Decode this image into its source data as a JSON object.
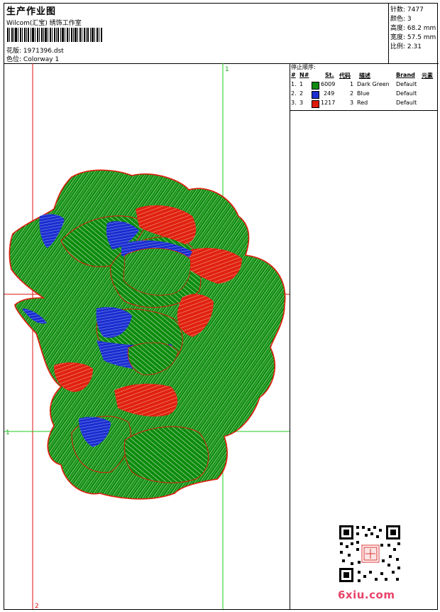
{
  "header": {
    "title": "生产作业图",
    "company": "Wilcom(汇宝) 绣饰工作室",
    "design_label": "花版:",
    "design_value": "1971396.dst",
    "colorway_label": "色位:",
    "colorway_value": "Colorway 1"
  },
  "specs": {
    "stitches": "针数: 7477",
    "colors": "颜色: 3",
    "height": "高度: 68.2 mm",
    "width": "宽度: 57.5 mm",
    "scale": "比例: 2.31"
  },
  "guides": {
    "top_label": "1",
    "left_label": "1",
    "bottom_label": "2"
  },
  "stop_sequence": {
    "title": "停止顺序:",
    "headers": {
      "hash": "#",
      "n": "N#",
      "st": "St.",
      "code": "代码",
      "desc": "描述",
      "brand": "Brand",
      "element": "元素"
    },
    "rows": [
      {
        "idx": "1.",
        "n": "1",
        "color": "#108a10",
        "st": "6009",
        "code": "1",
        "desc": "Dark Green",
        "brand": "Default"
      },
      {
        "idx": "2.",
        "n": "2",
        "color": "#1a2ed0",
        "st": "249",
        "code": "2",
        "desc": "Blue",
        "brand": "Default"
      },
      {
        "idx": "3.",
        "n": "3",
        "color": "#e01a0a",
        "st": "1217",
        "code": "3",
        "desc": "Red",
        "brand": "Default"
      }
    ]
  },
  "watermark": "6xiu.com",
  "colors": {
    "green": "#0a8a0a",
    "blue": "#1a2ed0",
    "red": "#e01a0a",
    "guide_green": "#22cc22",
    "guide_red": "#dd1111"
  }
}
